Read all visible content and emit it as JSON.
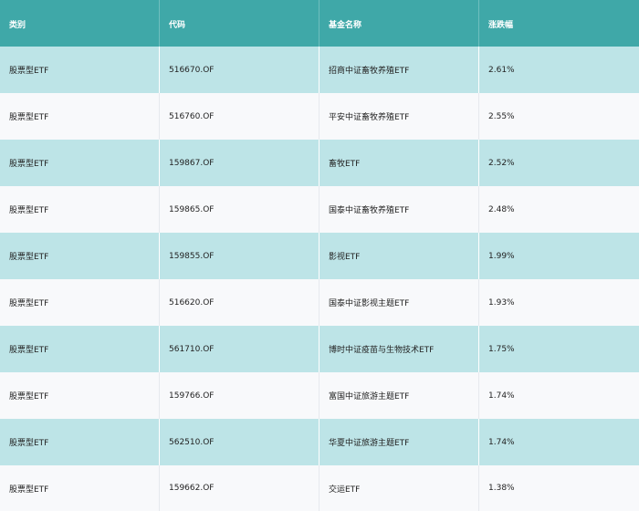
{
  "table": {
    "headers": [
      "类别",
      "代码",
      "基金名称",
      "涨跌幅"
    ],
    "rows": [
      [
        "股票型ETF",
        "516670.OF",
        "招商中证畜牧养殖ETF",
        "2.61%"
      ],
      [
        "股票型ETF",
        "516760.OF",
        "平安中证畜牧养殖ETF",
        "2.55%"
      ],
      [
        "股票型ETF",
        "159867.OF",
        "畜牧ETF",
        "2.52%"
      ],
      [
        "股票型ETF",
        "159865.OF",
        "国泰中证畜牧养殖ETF",
        "2.48%"
      ],
      [
        "股票型ETF",
        "159855.OF",
        "影视ETF",
        "1.99%"
      ],
      [
        "股票型ETF",
        "516620.OF",
        "国泰中证影视主题ETF",
        "1.93%"
      ],
      [
        "股票型ETF",
        "561710.OF",
        "博时中证疫苗与生物技术ETF",
        "1.75%"
      ],
      [
        "股票型ETF",
        "159766.OF",
        "富国中证旅游主题ETF",
        "1.74%"
      ],
      [
        "股票型ETF",
        "562510.OF",
        "华夏中证旅游主题ETF",
        "1.74%"
      ],
      [
        "股票型ETF",
        "159662.OF",
        "交运ETF",
        "1.38%"
      ]
    ]
  },
  "colors": {
    "header_bg": "#3fa8a8",
    "row_odd_bg": "#bde4e7",
    "row_even_bg": "#f8f9fb"
  }
}
